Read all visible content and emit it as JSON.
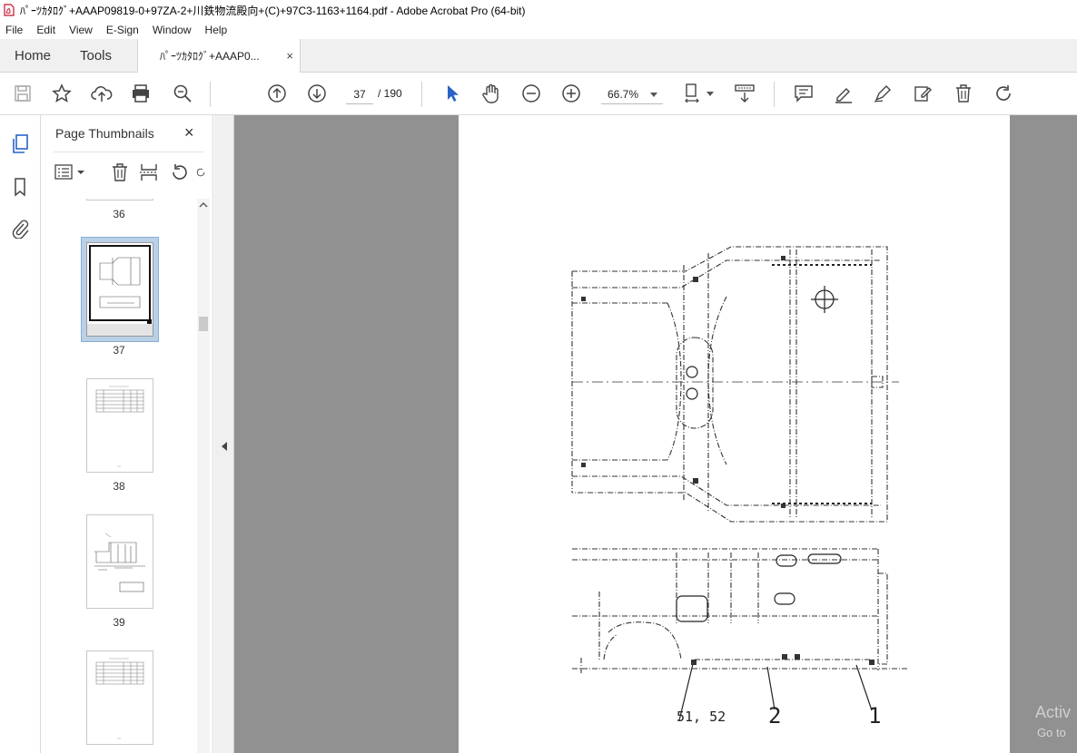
{
  "window": {
    "title": "ﾊﾟｰﾂｶﾀﾛｸﾞ+AAAP09819-0+97ZA-2+川鉄物流殿向+(C)+97C3-1163+1164.pdf - Adobe Acrobat Pro (64-bit)"
  },
  "menu": {
    "file": "File",
    "edit": "Edit",
    "view": "View",
    "esign": "E-Sign",
    "window": "Window",
    "help": "Help"
  },
  "tabs": {
    "home": "Home",
    "tools": "Tools",
    "document": "ﾊﾟｰﾂｶﾀﾛｸﾞ+AAAP0...",
    "close": "×"
  },
  "toolbar": {
    "current_page": "37",
    "page_total": "/  190",
    "zoom": "66.7%"
  },
  "thumbnails_panel": {
    "title": "Page Thumbnails",
    "close": "×",
    "pages": [
      "36",
      "37",
      "38",
      "39"
    ],
    "selected_page": "37"
  },
  "drawing": {
    "callout_51_52": "51, 52",
    "callout_2": "2",
    "callout_1": "1"
  },
  "watermark": {
    "line1": "Activ",
    "line2": "Go to"
  },
  "colors": {
    "accent_blue": "#2a63c7",
    "document_background": "#919191",
    "panel_selection": "#b9d1e8"
  }
}
